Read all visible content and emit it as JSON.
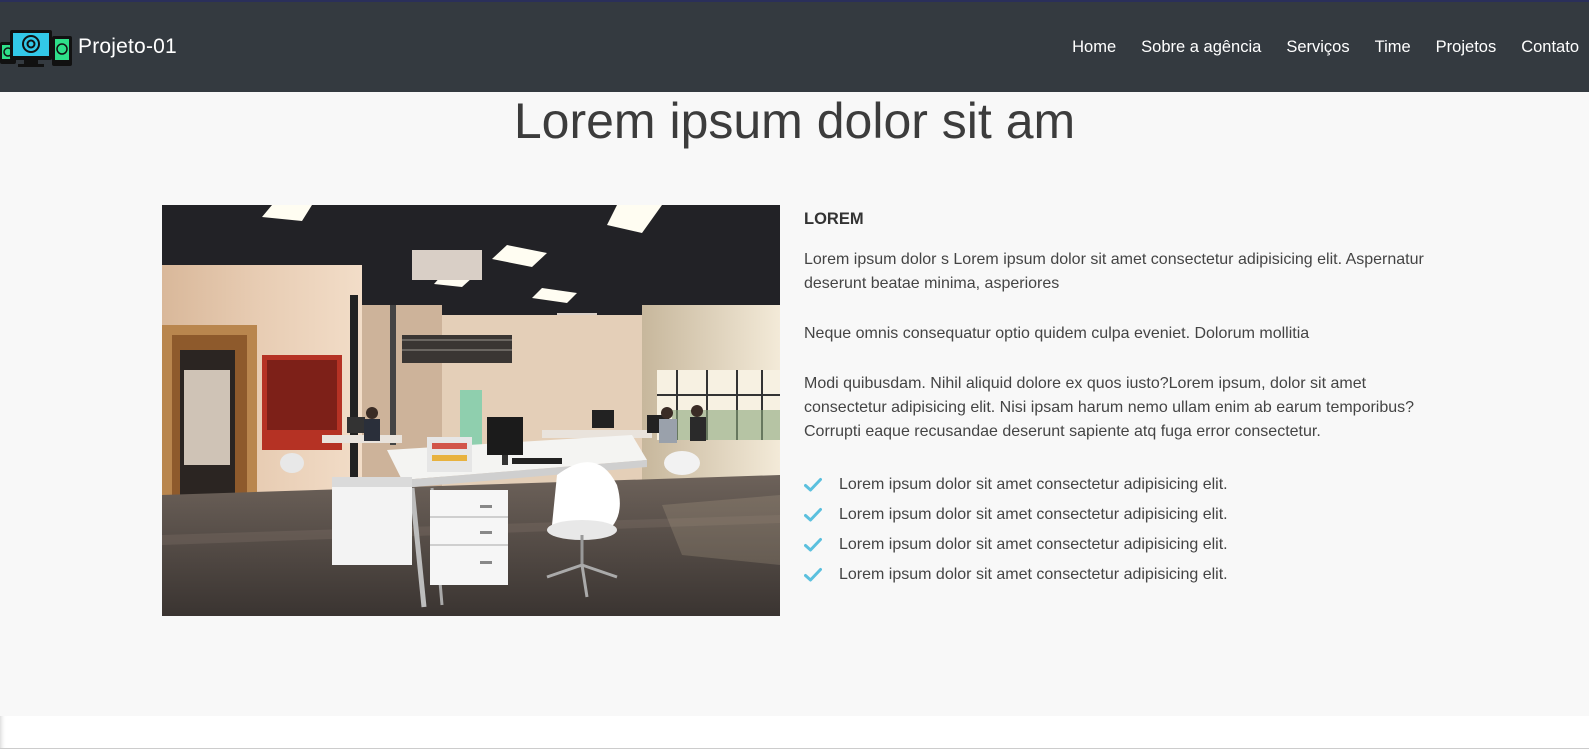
{
  "header": {
    "brand_name": "Projeto-01",
    "nav": [
      {
        "label": "Home"
      },
      {
        "label": "Sobre a agência"
      },
      {
        "label": "Serviços"
      },
      {
        "label": "Time"
      },
      {
        "label": "Projetos"
      },
      {
        "label": "Contato"
      }
    ]
  },
  "about": {
    "title": "Lorem ipsum dolor sit am",
    "heading": "LOREM",
    "paragraphs": [
      "Lorem ipsum dolor s Lorem ipsum dolor sit amet consectetur adipisicing elit. Aspernatur deserunt beatae minima, asperiores",
      "Neque omnis consequatur optio quidem culpa eveniet. Dolorum mollitia",
      "Modi quibusdam. Nihil aliquid dolore ex quos iusto?Lorem ipsum, dolor sit amet consectetur adipisicing elit. Nisi ipsam harum nemo ullam enim ab earum temporibus? Corrupti eaque recusandae deserunt sapiente atq fuga error consectetur."
    ],
    "checklist": [
      "Lorem ipsum dolor sit amet consectetur adipisicing elit.",
      "Lorem ipsum dolor sit amet consectetur adipisicing elit.",
      "Lorem ipsum dolor sit amet consectetur adipisicing elit.",
      "Lorem ipsum dolor sit amet consectetur adipisicing elit."
    ]
  },
  "colors": {
    "navbar": "#343a40",
    "check": "#5bc0de",
    "background": "#f8f8f8"
  }
}
